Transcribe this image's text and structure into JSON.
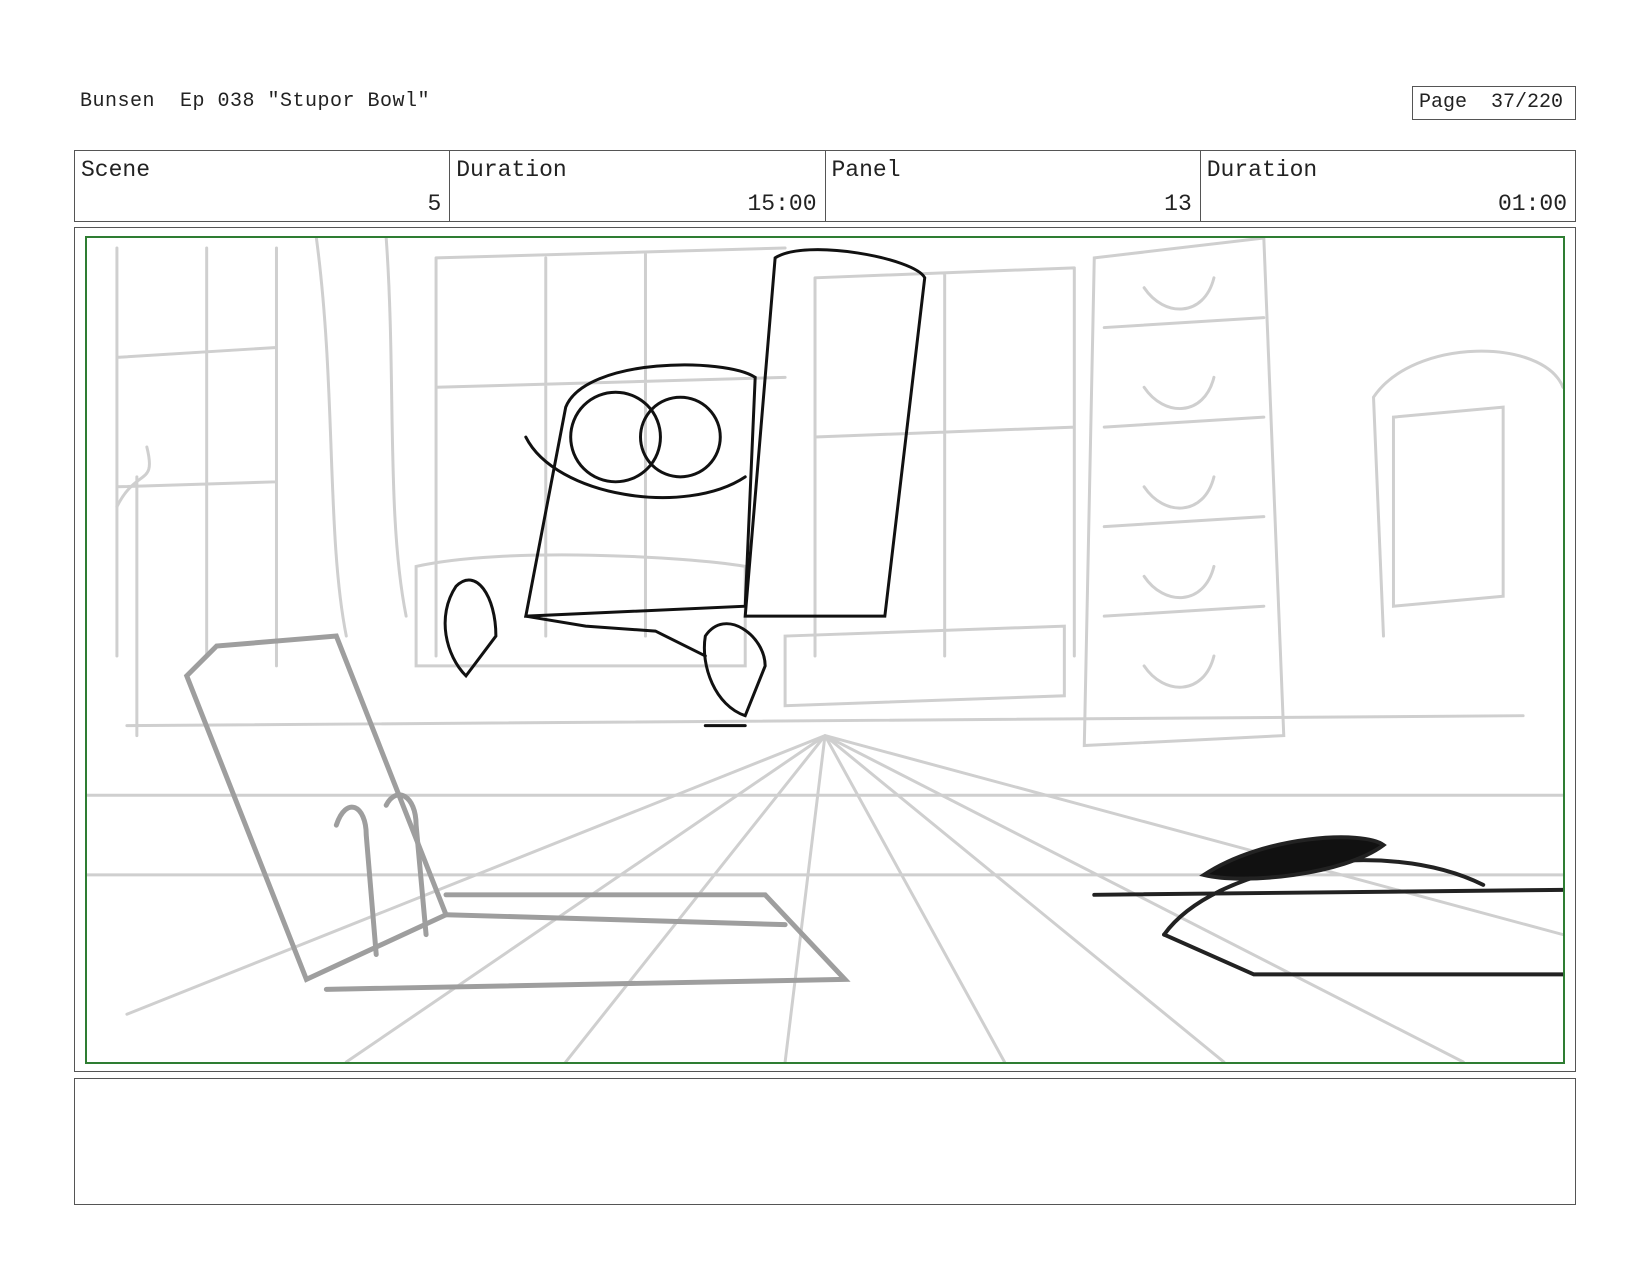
{
  "header": {
    "title": "Bunsen  Ep 038 \"Stupor Bowl\"",
    "page": "Page  37/220"
  },
  "info": {
    "scene_label": "Scene",
    "scene_value": "5",
    "scene_duration_label": "Duration",
    "scene_duration_value": "15:00",
    "panel_label": "Panel",
    "panel_value": "13",
    "panel_duration_label": "Duration",
    "panel_duration_value": "01:00"
  },
  "notes": {
    "text": ""
  }
}
